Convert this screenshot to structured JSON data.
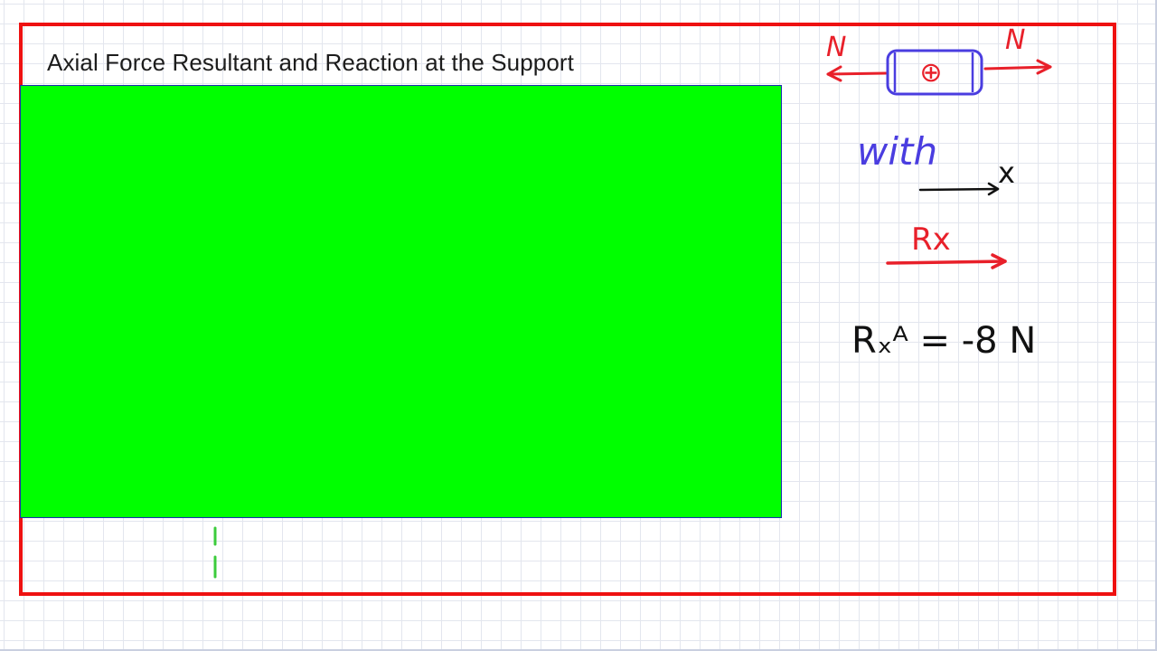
{
  "page": {
    "title": "Axial Force Resultant and Reaction at the Support"
  },
  "sketch": {
    "force_symbol_left": "N",
    "force_symbol_right": "N",
    "sign": "⊕",
    "with_label": "with",
    "axis_label": "x",
    "reaction_label": "Rx",
    "reaction_equation": "Rₓᴬ = -8 N"
  },
  "colors": {
    "frame": "#ee1111",
    "panel": "#00ff00",
    "panel_border": "#1a2fb0",
    "ink_red": "#e8202a",
    "ink_blue": "#4a3de0",
    "ink_black": "#111111"
  }
}
